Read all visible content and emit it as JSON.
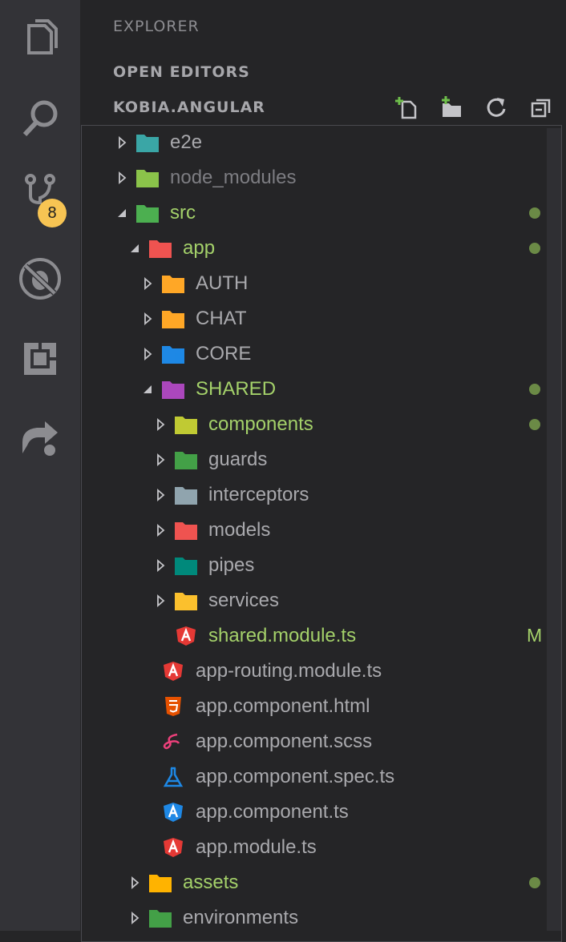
{
  "activity_bar": {
    "items": [
      {
        "icon": "files-icon"
      },
      {
        "icon": "search-icon"
      },
      {
        "icon": "source-control-icon",
        "badge": "8"
      },
      {
        "icon": "debug-disabled-icon"
      },
      {
        "icon": "extensions-icon"
      },
      {
        "icon": "remote-share-icon"
      }
    ]
  },
  "sidebar": {
    "title": "EXPLORER",
    "open_editors": "OPEN EDITORS",
    "project": "KOBIA.ANGULAR",
    "toolbar": [
      "new-file-icon",
      "new-folder-icon",
      "refresh-icon",
      "collapse-all-icon"
    ]
  },
  "tree": [
    {
      "name": "e2e",
      "depth": 0,
      "type": "folder",
      "expanded": false,
      "icon": "folder-e2e-icon",
      "color": "#3aa6a6",
      "status": ""
    },
    {
      "name": "node_modules",
      "depth": 0,
      "type": "folder",
      "expanded": false,
      "icon": "folder-node-icon",
      "color": "#8bc34a",
      "status": "",
      "dim": true
    },
    {
      "name": "src",
      "depth": 0,
      "type": "folder",
      "expanded": true,
      "icon": "folder-src-icon",
      "color": "#4caf50",
      "status": "dot"
    },
    {
      "name": "app",
      "depth": 1,
      "type": "folder",
      "expanded": true,
      "icon": "folder-app-icon",
      "color": "#ef5350",
      "status": "dot"
    },
    {
      "name": "AUTH",
      "depth": 2,
      "type": "folder",
      "expanded": false,
      "icon": "folder-auth-icon",
      "color": "#ffa726",
      "status": ""
    },
    {
      "name": "CHAT",
      "depth": 2,
      "type": "folder",
      "expanded": false,
      "icon": "folder-chat-icon",
      "color": "#ffa726",
      "status": ""
    },
    {
      "name": "CORE",
      "depth": 2,
      "type": "folder",
      "expanded": false,
      "icon": "folder-core-icon",
      "color": "#1e88e5",
      "status": ""
    },
    {
      "name": "SHARED",
      "depth": 2,
      "type": "folder",
      "expanded": true,
      "icon": "folder-shared-icon",
      "color": "#ab47bc",
      "status": "dot"
    },
    {
      "name": "components",
      "depth": 3,
      "type": "folder",
      "expanded": false,
      "icon": "folder-components-icon",
      "color": "#c0ca33",
      "status": "dot"
    },
    {
      "name": "guards",
      "depth": 3,
      "type": "folder",
      "expanded": false,
      "icon": "folder-guards-icon",
      "color": "#43a047",
      "status": ""
    },
    {
      "name": "interceptors",
      "depth": 3,
      "type": "folder",
      "expanded": false,
      "icon": "folder-icon",
      "color": "#90a4ae",
      "status": ""
    },
    {
      "name": "models",
      "depth": 3,
      "type": "folder",
      "expanded": false,
      "icon": "folder-models-icon",
      "color": "#ef5350",
      "status": ""
    },
    {
      "name": "pipes",
      "depth": 3,
      "type": "folder",
      "expanded": false,
      "icon": "folder-pipes-icon",
      "color": "#00897b",
      "status": ""
    },
    {
      "name": "services",
      "depth": 3,
      "type": "folder",
      "expanded": false,
      "icon": "folder-services-icon",
      "color": "#fbc02d",
      "status": ""
    },
    {
      "name": "shared.module.ts",
      "depth": 3,
      "type": "file",
      "icon": "angular-icon",
      "color": "#e53935",
      "status": "M"
    },
    {
      "name": "app-routing.module.ts",
      "depth": 2,
      "type": "file",
      "icon": "angular-routing-icon",
      "color": "#e53935",
      "status": ""
    },
    {
      "name": "app.component.html",
      "depth": 2,
      "type": "file",
      "icon": "html5-icon",
      "color": "#e65100",
      "status": ""
    },
    {
      "name": "app.component.scss",
      "depth": 2,
      "type": "file",
      "icon": "sass-icon",
      "color": "#ec407a",
      "status": ""
    },
    {
      "name": "app.component.spec.ts",
      "depth": 2,
      "type": "file",
      "icon": "test-flask-icon",
      "color": "#1e88e5",
      "status": ""
    },
    {
      "name": "app.component.ts",
      "depth": 2,
      "type": "file",
      "icon": "angular-component-icon",
      "color": "#1e88e5",
      "status": ""
    },
    {
      "name": "app.module.ts",
      "depth": 2,
      "type": "file",
      "icon": "angular-icon",
      "color": "#e53935",
      "status": ""
    },
    {
      "name": "assets",
      "depth": 1,
      "type": "folder",
      "expanded": false,
      "icon": "folder-assets-icon",
      "color": "#ffb300",
      "status": "dot"
    },
    {
      "name": "environments",
      "depth": 1,
      "type": "folder",
      "expanded": false,
      "icon": "folder-environment-icon",
      "color": "#43a047",
      "status": ""
    }
  ]
}
